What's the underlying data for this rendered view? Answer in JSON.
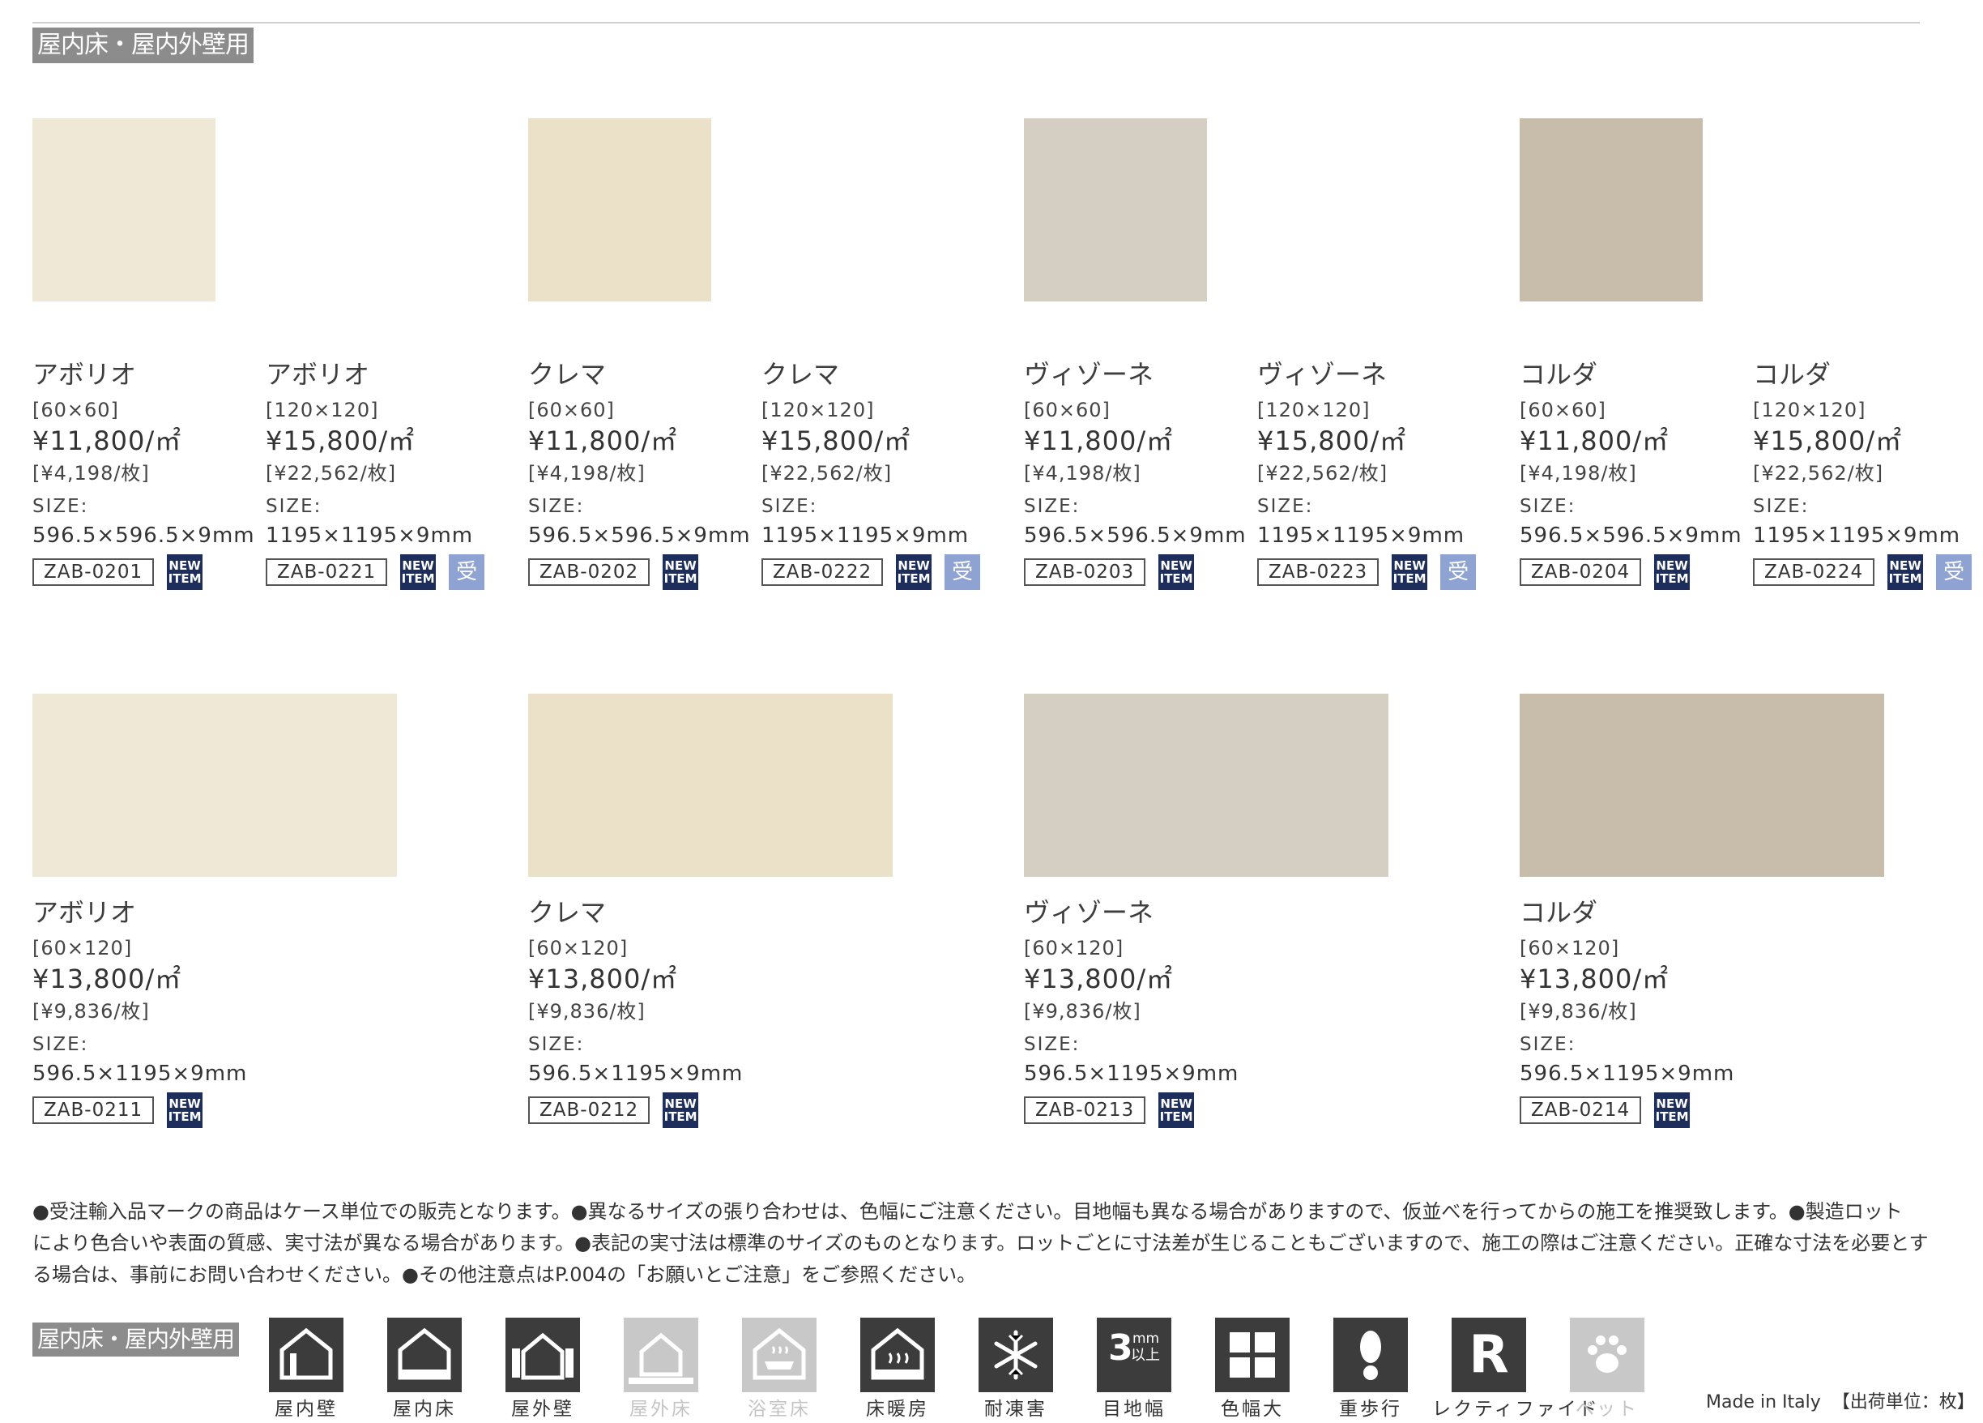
{
  "category_label": "屋内床・屋内外壁用",
  "icons_label": "屋内床・屋内外壁用",
  "products_row1": [
    {
      "name": "アボリオ",
      "dim": "[60×60]",
      "price": "¥11,800/㎡",
      "piece": "[¥4,198/枚]",
      "size_label": "SIZE:",
      "size": "596.5×596.5×9mm",
      "code": "ZAB-0201",
      "new": "NEW ITEM",
      "uke": ""
    },
    {
      "name": "アボリオ",
      "dim": "[120×120]",
      "price": "¥15,800/㎡",
      "piece": "[¥22,562/枚]",
      "size_label": "SIZE:",
      "size": "1195×1195×9mm",
      "code": "ZAB-0221",
      "new": "NEW ITEM",
      "uke": "受"
    },
    {
      "name": "クレマ",
      "dim": "[60×60]",
      "price": "¥11,800/㎡",
      "piece": "[¥4,198/枚]",
      "size_label": "SIZE:",
      "size": "596.5×596.5×9mm",
      "code": "ZAB-0202",
      "new": "NEW ITEM",
      "uke": ""
    },
    {
      "name": "クレマ",
      "dim": "[120×120]",
      "price": "¥15,800/㎡",
      "piece": "[¥22,562/枚]",
      "size_label": "SIZE:",
      "size": "1195×1195×9mm",
      "code": "ZAB-0222",
      "new": "NEW ITEM",
      "uke": "受"
    },
    {
      "name": "ヴィゾーネ",
      "dim": "[60×60]",
      "price": "¥11,800/㎡",
      "piece": "[¥4,198/枚]",
      "size_label": "SIZE:",
      "size": "596.5×596.5×9mm",
      "code": "ZAB-0203",
      "new": "NEW ITEM",
      "uke": ""
    },
    {
      "name": "ヴィゾーネ",
      "dim": "[120×120]",
      "price": "¥15,800/㎡",
      "piece": "[¥22,562/枚]",
      "size_label": "SIZE:",
      "size": "1195×1195×9mm",
      "code": "ZAB-0223",
      "new": "NEW ITEM",
      "uke": "受"
    },
    {
      "name": "コルダ",
      "dim": "[60×60]",
      "price": "¥11,800/㎡",
      "piece": "[¥4,198/枚]",
      "size_label": "SIZE:",
      "size": "596.5×596.5×9mm",
      "code": "ZAB-0204",
      "new": "NEW ITEM",
      "uke": ""
    },
    {
      "name": "コルダ",
      "dim": "[120×120]",
      "price": "¥15,800/㎡",
      "piece": "[¥22,562/枚]",
      "size_label": "SIZE:",
      "size": "1195×1195×9mm",
      "code": "ZAB-0224",
      "new": "NEW ITEM",
      "uke": "受"
    }
  ],
  "products_row2": [
    {
      "name": "アボリオ",
      "dim": "[60×120]",
      "price": "¥13,800/㎡",
      "piece": "[¥9,836/枚]",
      "size_label": "SIZE:",
      "size": "596.5×1195×9mm",
      "code": "ZAB-0211",
      "new": "NEW ITEM"
    },
    {
      "name": "クレマ",
      "dim": "[60×120]",
      "price": "¥13,800/㎡",
      "piece": "[¥9,836/枚]",
      "size_label": "SIZE:",
      "size": "596.5×1195×9mm",
      "code": "ZAB-0212",
      "new": "NEW ITEM"
    },
    {
      "name": "ヴィゾーネ",
      "dim": "[60×120]",
      "price": "¥13,800/㎡",
      "piece": "[¥9,836/枚]",
      "size_label": "SIZE:",
      "size": "596.5×1195×9mm",
      "code": "ZAB-0213",
      "new": "NEW ITEM"
    },
    {
      "name": "コルダ",
      "dim": "[60×120]",
      "price": "¥13,800/㎡",
      "piece": "[¥9,836/枚]",
      "size_label": "SIZE:",
      "size": "596.5×1195×9mm",
      "code": "ZAB-0214",
      "new": "NEW ITEM"
    }
  ],
  "swatch_colors": {
    "abolio": "#efe8d6",
    "crema": "#ebe1c8",
    "visone": "#d4cfc2",
    "corda": "#c8bcab"
  },
  "notes": [
    "●受注輸入品マークの商品はケース単位での販売となります。●異なるサイズの張り合わせは、色幅にご注意ください。目地幅も異なる場合がありますので、仮並べを行ってからの施工を推奨致します。●製造ロット",
    "により色合いや表面の質感、実寸法が異なる場合があります。●表記の実寸法は標準のサイズのものとなります。ロットごとに寸法差が生じることもございますので、施工の際はご注意ください。正確な寸法を必要とす",
    "る場合は、事前にお問い合わせください。●その他注意点はP.004の「お願いとご注意」をご参照ください。"
  ],
  "icons": [
    {
      "label": "屋内壁",
      "icon": "indoor-wall-icon",
      "active": true
    },
    {
      "label": "屋内床",
      "icon": "indoor-floor-icon",
      "active": true
    },
    {
      "label": "屋外壁",
      "icon": "outdoor-wall-icon",
      "active": true
    },
    {
      "label": "屋外床",
      "icon": "outdoor-floor-icon",
      "active": false
    },
    {
      "label": "浴室床",
      "icon": "bathroom-floor-icon",
      "active": false
    },
    {
      "label": "床暖房",
      "icon": "floor-heating-icon",
      "active": true
    },
    {
      "label": "耐凍害",
      "icon": "frost-resistant-icon",
      "active": true
    },
    {
      "label": "目地幅",
      "icon": "joint-width-icon",
      "active": true,
      "badge_main": "3",
      "badge_unit": "mm",
      "badge_sub": "以上"
    },
    {
      "label": "色幅大",
      "icon": "color-variation-icon",
      "active": true
    },
    {
      "label": "重歩行",
      "icon": "heavy-walking-icon",
      "active": true
    },
    {
      "label": "レクティファイド",
      "icon": "rectified-icon",
      "active": true,
      "badge_letter": "R"
    },
    {
      "label": "ペット",
      "icon": "pet-icon",
      "active": false
    }
  ],
  "origin": "Made in Italy",
  "shipping_unit": "【出荷単位：枚】"
}
